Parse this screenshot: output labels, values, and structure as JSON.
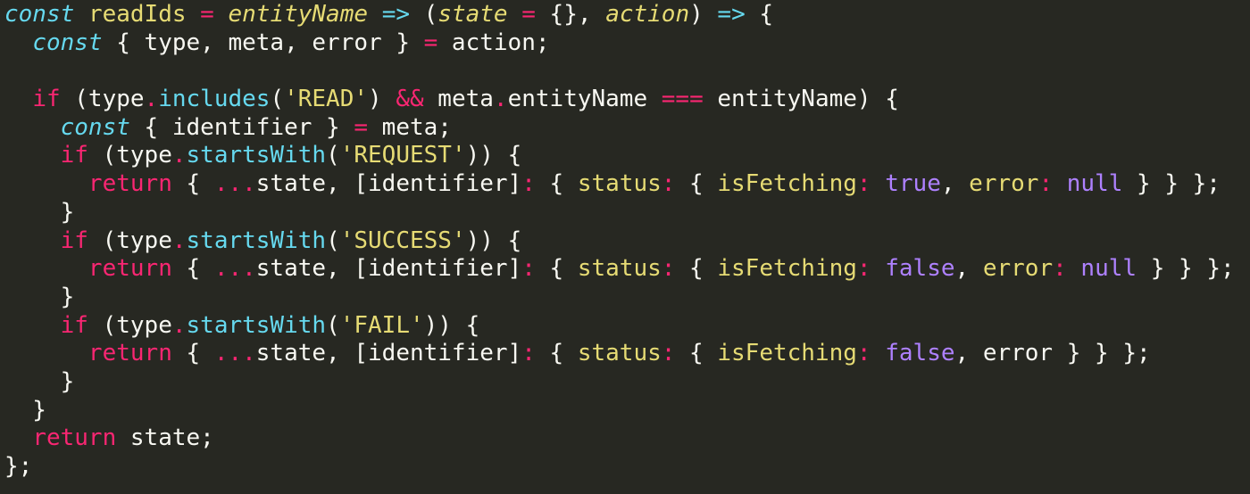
{
  "editor": {
    "theme_colors": {
      "background": "#272822",
      "text": "#f8f8f2",
      "keyword": "#66d9ef",
      "control": "#f92672",
      "string": "#e6db74",
      "constant": "#ae81ff",
      "parameter": "#fd971f"
    },
    "lines": [
      [
        {
          "t": "const",
          "c": "kw"
        },
        {
          "t": " ",
          "c": "txt"
        },
        {
          "t": "readIds",
          "c": "name"
        },
        {
          "t": " ",
          "c": "txt"
        },
        {
          "t": "=",
          "c": "op"
        },
        {
          "t": " ",
          "c": "txt"
        },
        {
          "t": "entityName",
          "c": "param"
        },
        {
          "t": " ",
          "c": "txt"
        },
        {
          "t": "=>",
          "c": "kw-plain"
        },
        {
          "t": " (",
          "c": "txt"
        },
        {
          "t": "state",
          "c": "param"
        },
        {
          "t": " ",
          "c": "txt"
        },
        {
          "t": "=",
          "c": "op"
        },
        {
          "t": " {}, ",
          "c": "txt"
        },
        {
          "t": "action",
          "c": "param"
        },
        {
          "t": ") ",
          "c": "txt"
        },
        {
          "t": "=>",
          "c": "kw-plain"
        },
        {
          "t": " {",
          "c": "txt"
        }
      ],
      [
        {
          "t": "  ",
          "c": "txt"
        },
        {
          "t": "const",
          "c": "kw"
        },
        {
          "t": " { type, meta, error } ",
          "c": "txt"
        },
        {
          "t": "=",
          "c": "op"
        },
        {
          "t": " action;",
          "c": "txt"
        }
      ],
      [
        {
          "t": "",
          "c": "txt"
        }
      ],
      [
        {
          "t": "  ",
          "c": "txt"
        },
        {
          "t": "if",
          "c": "ctrl"
        },
        {
          "t": " (type",
          "c": "txt"
        },
        {
          "t": ".",
          "c": "op"
        },
        {
          "t": "includes",
          "c": "meth"
        },
        {
          "t": "(",
          "c": "txt"
        },
        {
          "t": "'READ'",
          "c": "str"
        },
        {
          "t": ") ",
          "c": "txt"
        },
        {
          "t": "&&",
          "c": "op"
        },
        {
          "t": " meta",
          "c": "txt"
        },
        {
          "t": ".",
          "c": "op"
        },
        {
          "t": "entityName ",
          "c": "txt"
        },
        {
          "t": "===",
          "c": "op"
        },
        {
          "t": " entityName) {",
          "c": "txt"
        }
      ],
      [
        {
          "t": "    ",
          "c": "txt"
        },
        {
          "t": "const",
          "c": "kw"
        },
        {
          "t": " { identifier } ",
          "c": "txt"
        },
        {
          "t": "=",
          "c": "op"
        },
        {
          "t": " meta;",
          "c": "txt"
        }
      ],
      [
        {
          "t": "    ",
          "c": "txt"
        },
        {
          "t": "if",
          "c": "ctrl"
        },
        {
          "t": " (type",
          "c": "txt"
        },
        {
          "t": ".",
          "c": "op"
        },
        {
          "t": "startsWith",
          "c": "meth"
        },
        {
          "t": "(",
          "c": "txt"
        },
        {
          "t": "'REQUEST'",
          "c": "str"
        },
        {
          "t": ")) {",
          "c": "txt"
        }
      ],
      [
        {
          "t": "      ",
          "c": "txt"
        },
        {
          "t": "return",
          "c": "ctrl"
        },
        {
          "t": " { ",
          "c": "txt"
        },
        {
          "t": "...",
          "c": "op"
        },
        {
          "t": "state, [identifier]",
          "c": "txt"
        },
        {
          "t": ":",
          "c": "op"
        },
        {
          "t": " { ",
          "c": "txt"
        },
        {
          "t": "status",
          "c": "key"
        },
        {
          "t": ":",
          "c": "op"
        },
        {
          "t": " { ",
          "c": "txt"
        },
        {
          "t": "isFetching",
          "c": "key"
        },
        {
          "t": ":",
          "c": "op"
        },
        {
          "t": " ",
          "c": "txt"
        },
        {
          "t": "true",
          "c": "const"
        },
        {
          "t": ", ",
          "c": "txt"
        },
        {
          "t": "error",
          "c": "key"
        },
        {
          "t": ":",
          "c": "op"
        },
        {
          "t": " ",
          "c": "txt"
        },
        {
          "t": "null",
          "c": "const"
        },
        {
          "t": " } } };",
          "c": "txt"
        }
      ],
      [
        {
          "t": "    }",
          "c": "txt"
        }
      ],
      [
        {
          "t": "    ",
          "c": "txt"
        },
        {
          "t": "if",
          "c": "ctrl"
        },
        {
          "t": " (type",
          "c": "txt"
        },
        {
          "t": ".",
          "c": "op"
        },
        {
          "t": "startsWith",
          "c": "meth"
        },
        {
          "t": "(",
          "c": "txt"
        },
        {
          "t": "'SUCCESS'",
          "c": "str"
        },
        {
          "t": ")) {",
          "c": "txt"
        }
      ],
      [
        {
          "t": "      ",
          "c": "txt"
        },
        {
          "t": "return",
          "c": "ctrl"
        },
        {
          "t": " { ",
          "c": "txt"
        },
        {
          "t": "...",
          "c": "op"
        },
        {
          "t": "state, [identifier]",
          "c": "txt"
        },
        {
          "t": ":",
          "c": "op"
        },
        {
          "t": " { ",
          "c": "txt"
        },
        {
          "t": "status",
          "c": "key"
        },
        {
          "t": ":",
          "c": "op"
        },
        {
          "t": " { ",
          "c": "txt"
        },
        {
          "t": "isFetching",
          "c": "key"
        },
        {
          "t": ":",
          "c": "op"
        },
        {
          "t": " ",
          "c": "txt"
        },
        {
          "t": "false",
          "c": "const"
        },
        {
          "t": ", ",
          "c": "txt"
        },
        {
          "t": "error",
          "c": "key"
        },
        {
          "t": ":",
          "c": "op"
        },
        {
          "t": " ",
          "c": "txt"
        },
        {
          "t": "null",
          "c": "const"
        },
        {
          "t": " } } };",
          "c": "txt"
        }
      ],
      [
        {
          "t": "    }",
          "c": "txt"
        }
      ],
      [
        {
          "t": "    ",
          "c": "txt"
        },
        {
          "t": "if",
          "c": "ctrl"
        },
        {
          "t": " (type",
          "c": "txt"
        },
        {
          "t": ".",
          "c": "op"
        },
        {
          "t": "startsWith",
          "c": "meth"
        },
        {
          "t": "(",
          "c": "txt"
        },
        {
          "t": "'FAIL'",
          "c": "str"
        },
        {
          "t": ")) {",
          "c": "txt"
        }
      ],
      [
        {
          "t": "      ",
          "c": "txt"
        },
        {
          "t": "return",
          "c": "ctrl"
        },
        {
          "t": " { ",
          "c": "txt"
        },
        {
          "t": "...",
          "c": "op"
        },
        {
          "t": "state, [identifier]",
          "c": "txt"
        },
        {
          "t": ":",
          "c": "op"
        },
        {
          "t": " { ",
          "c": "txt"
        },
        {
          "t": "status",
          "c": "key"
        },
        {
          "t": ":",
          "c": "op"
        },
        {
          "t": " { ",
          "c": "txt"
        },
        {
          "t": "isFetching",
          "c": "key"
        },
        {
          "t": ":",
          "c": "op"
        },
        {
          "t": " ",
          "c": "txt"
        },
        {
          "t": "false",
          "c": "const"
        },
        {
          "t": ", error } } };",
          "c": "txt"
        }
      ],
      [
        {
          "t": "    }",
          "c": "txt"
        }
      ],
      [
        {
          "t": "  }",
          "c": "txt"
        }
      ],
      [
        {
          "t": "  ",
          "c": "txt"
        },
        {
          "t": "return",
          "c": "ctrl"
        },
        {
          "t": " state;",
          "c": "txt"
        }
      ],
      [
        {
          "t": "};",
          "c": "txt"
        }
      ]
    ]
  }
}
